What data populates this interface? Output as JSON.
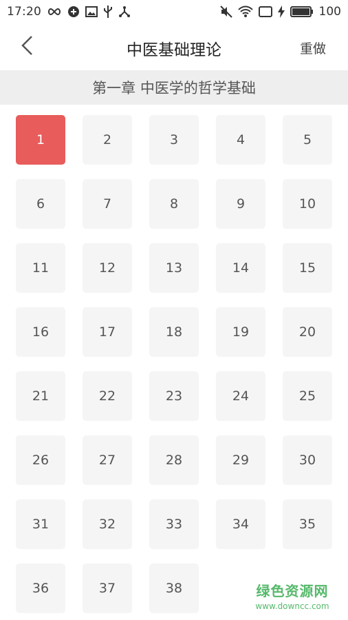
{
  "status_bar": {
    "time": "17:20",
    "battery_level": "100",
    "left_icons": [
      "infinity-icon",
      "sync-icon",
      "image-icon",
      "usb-icon",
      "share-icon"
    ],
    "right_icons": [
      "mute-icon",
      "wifi-icon",
      "screen-icon",
      "charging-icon",
      "battery-icon"
    ]
  },
  "header": {
    "title": "中医基础理论",
    "redo_label": "重做",
    "back_icon": "chevron-left-icon"
  },
  "chapter": {
    "title": "第一章 中医学的哲学基础"
  },
  "questions": {
    "active_index": 0,
    "items": [
      "1",
      "2",
      "3",
      "4",
      "5",
      "6",
      "7",
      "8",
      "9",
      "10",
      "11",
      "12",
      "13",
      "14",
      "15",
      "16",
      "17",
      "18",
      "19",
      "20",
      "21",
      "22",
      "23",
      "24",
      "25",
      "26",
      "27",
      "28",
      "29",
      "30",
      "31",
      "32",
      "33",
      "34",
      "35",
      "36",
      "37",
      "38"
    ]
  },
  "watermark": {
    "line1": "绿色资源网",
    "line2": "www.downcc.com"
  },
  "colors": {
    "active": "#e85c5c",
    "cell_bg": "#f5f5f5",
    "chapter_bg": "#eeeeee",
    "watermark": "#56b96b"
  }
}
